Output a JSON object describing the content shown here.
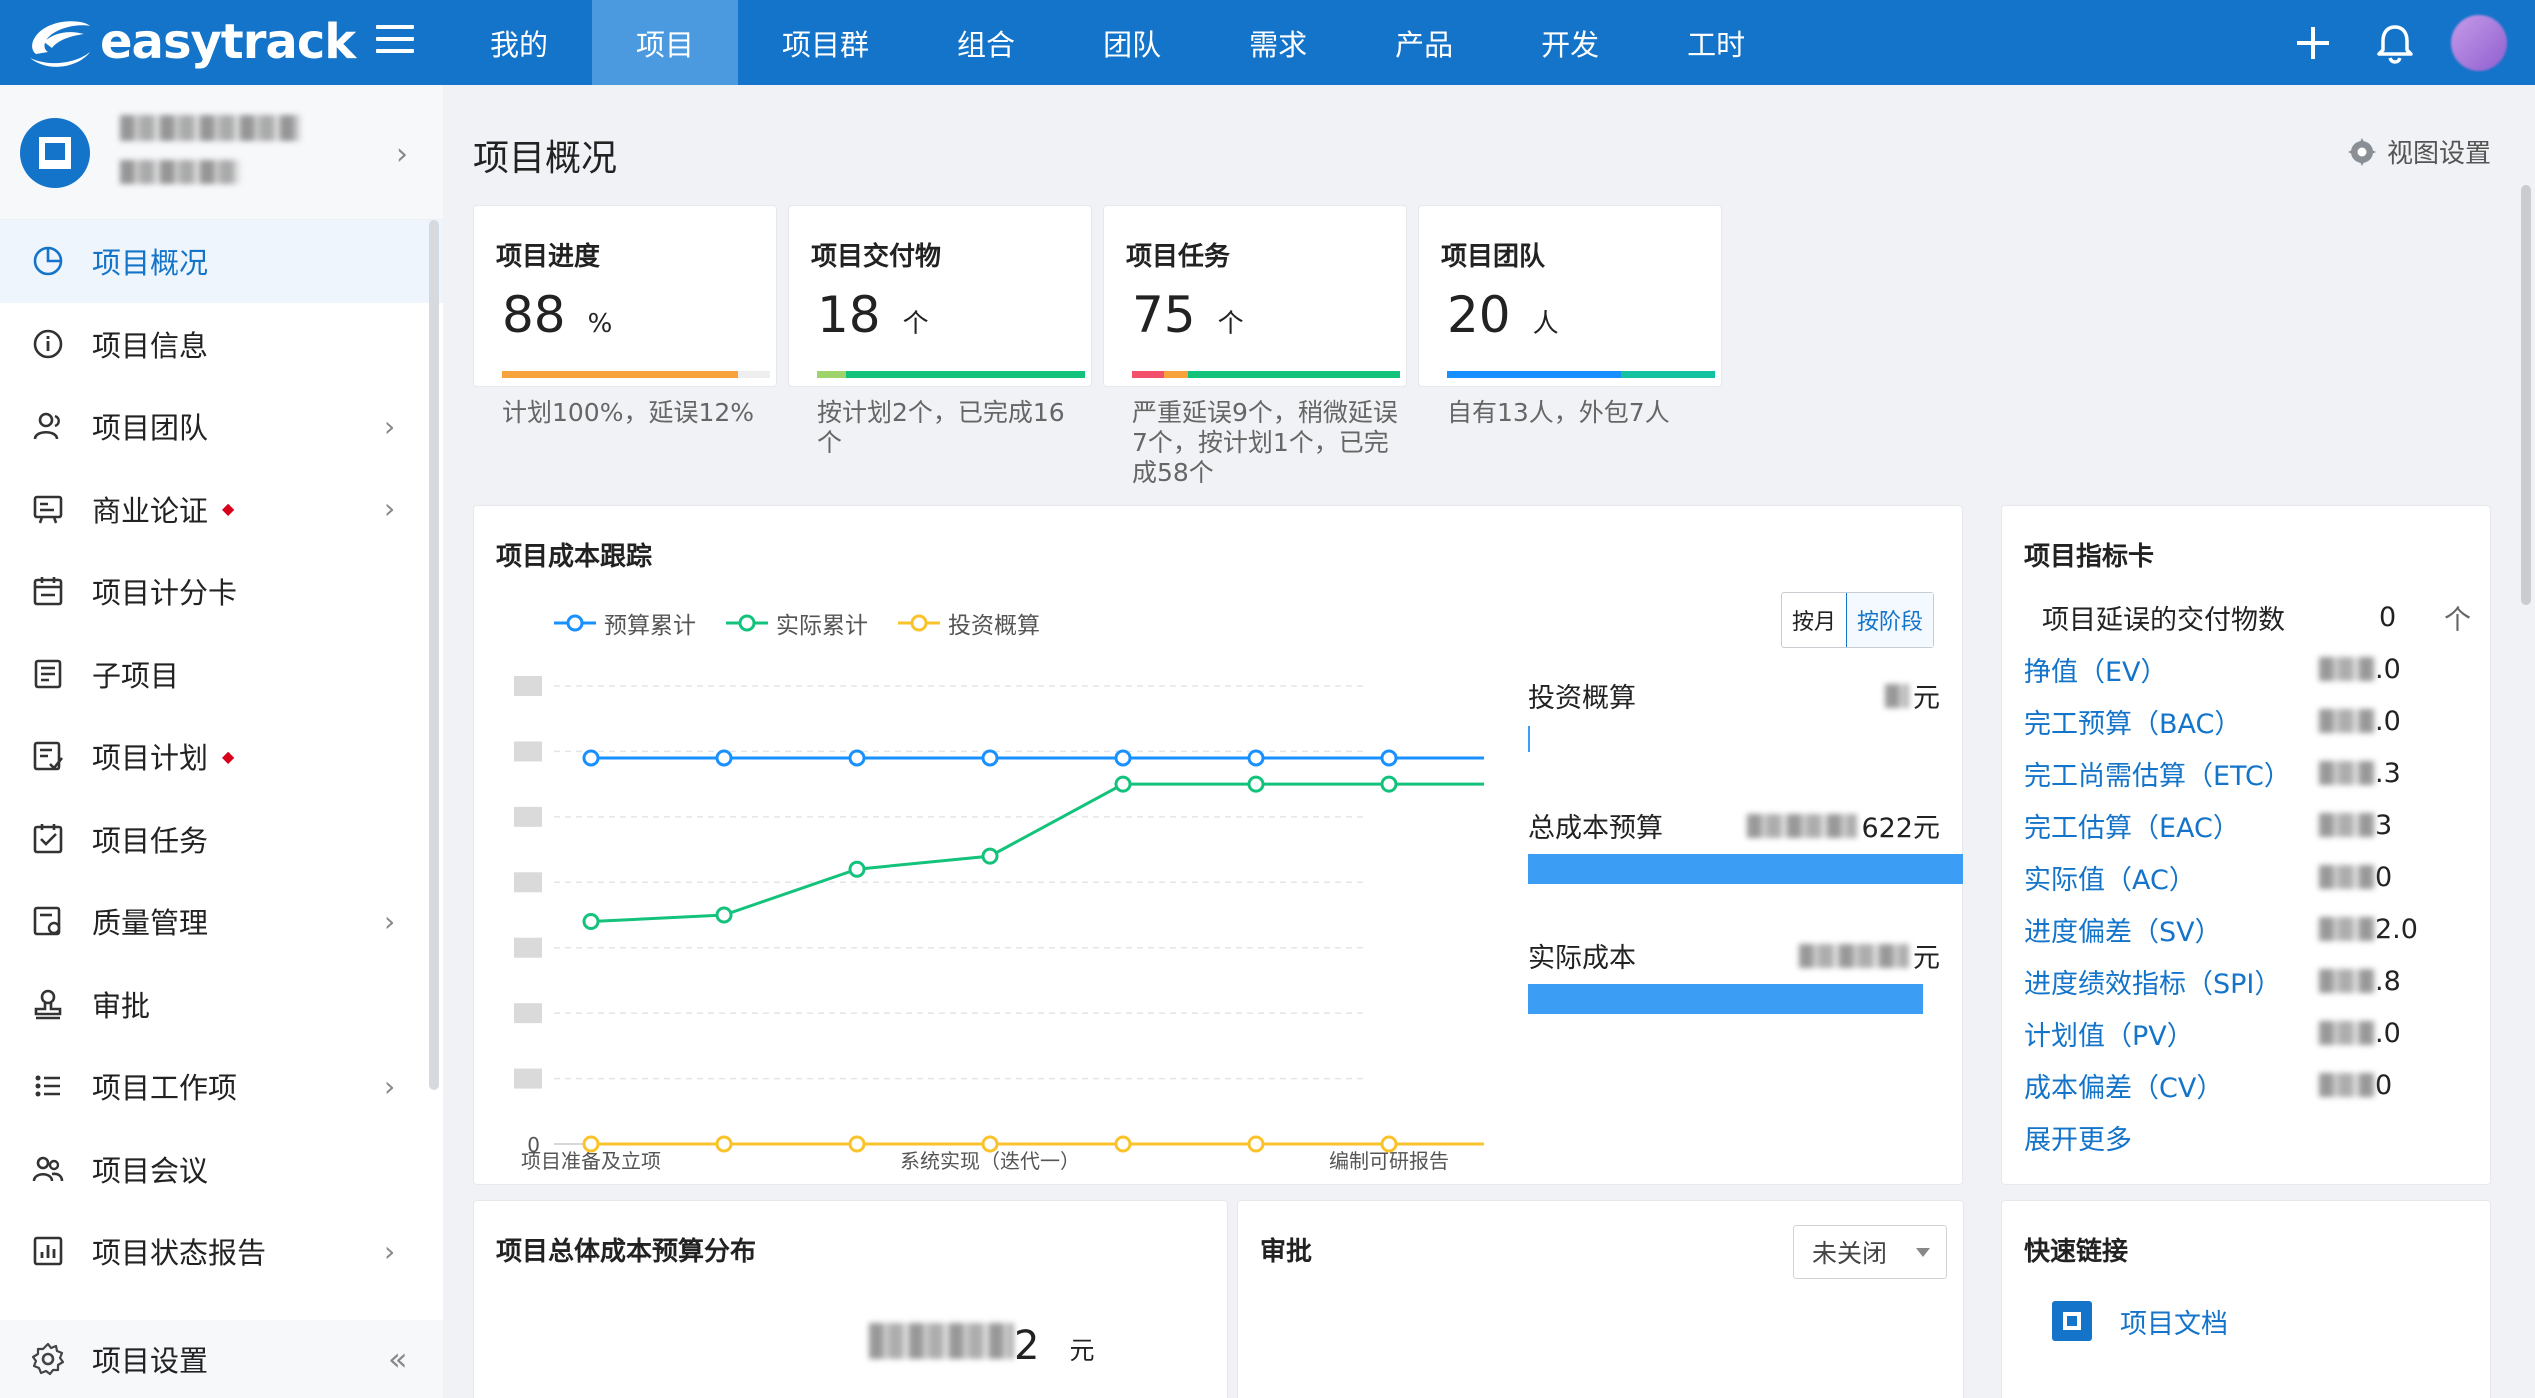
{
  "app": {
    "name": "easytrack"
  },
  "nav": {
    "items": [
      "我的",
      "项目",
      "项目群",
      "组合",
      "团队",
      "需求",
      "产品",
      "开发",
      "工时"
    ],
    "active_index": 1
  },
  "sidebar": {
    "items": [
      {
        "label": "项目概况",
        "icon": "pie-chart-icon",
        "active": true,
        "chevron": false,
        "dot": false
      },
      {
        "label": "项目信息",
        "icon": "info-icon",
        "active": false,
        "chevron": false,
        "dot": false
      },
      {
        "label": "项目团队",
        "icon": "team-icon",
        "active": false,
        "chevron": true,
        "dot": false
      },
      {
        "label": "商业论证",
        "icon": "business-case-icon",
        "active": false,
        "chevron": true,
        "dot": true
      },
      {
        "label": "项目计分卡",
        "icon": "scorecard-icon",
        "active": false,
        "chevron": false,
        "dot": false
      },
      {
        "label": "子项目",
        "icon": "subproject-icon",
        "active": false,
        "chevron": false,
        "dot": false
      },
      {
        "label": "项目计划",
        "icon": "plan-icon",
        "active": false,
        "chevron": false,
        "dot": true
      },
      {
        "label": "项目任务",
        "icon": "task-icon",
        "active": false,
        "chevron": false,
        "dot": false
      },
      {
        "label": "质量管理",
        "icon": "quality-icon",
        "active": false,
        "chevron": true,
        "dot": false
      },
      {
        "label": "审批",
        "icon": "approval-icon",
        "active": false,
        "chevron": false,
        "dot": false
      },
      {
        "label": "项目工作项",
        "icon": "work-items-icon",
        "active": false,
        "chevron": true,
        "dot": false
      },
      {
        "label": "项目会议",
        "icon": "meeting-icon",
        "active": false,
        "chevron": false,
        "dot": false
      },
      {
        "label": "项目状态报告",
        "icon": "status-report-icon",
        "active": false,
        "chevron": true,
        "dot": false
      }
    ],
    "footer": {
      "label": "项目设置",
      "icon": "gear-icon"
    }
  },
  "page": {
    "title": "项目概况",
    "view_settings": "视图设置"
  },
  "kpis": [
    {
      "title": "项目进度",
      "value": "88",
      "unit": "%",
      "note": "计划100%，延误12%",
      "progress": 0.88
    },
    {
      "title": "项目交付物",
      "value": "18",
      "unit": "个",
      "note": "按计划2个，已完成16个"
    },
    {
      "title": "项目任务",
      "value": "75",
      "unit": "个",
      "note": "严重延误9个，稍微延误7个，按计划1个，已完成58个"
    },
    {
      "title": "项目团队",
      "value": "20",
      "unit": "人",
      "note": "自有13人，外包7人"
    }
  ],
  "cost_tracking": {
    "title": "项目成本跟踪",
    "legend": [
      "预算累计",
      "实际累计",
      "投资概算"
    ],
    "toggle": [
      "按月",
      "按阶段"
    ],
    "toggle_active": 1,
    "x_labels": [
      "项目准备及立项",
      "系统实现（迭代一）",
      "编制可研报告"
    ],
    "y_zero": "0",
    "rows": [
      {
        "label": "投资概算",
        "suffix": "元"
      },
      {
        "label": "总成本预算",
        "suffix": "622元"
      },
      {
        "label": "实际成本",
        "suffix": "元"
      }
    ]
  },
  "chart_data": {
    "type": "line",
    "title": "项目成本跟踪",
    "x": [
      1,
      2,
      3,
      4,
      5,
      6,
      7,
      8
    ],
    "tick_labels": [
      "项目准备及立项",
      "系统实现（迭代一）",
      "编制可研报告"
    ],
    "series": [
      {
        "name": "预算累计",
        "color": "#1890ff",
        "values": [
          5.9,
          5.9,
          5.9,
          5.9,
          5.9,
          5.9,
          5.9,
          5.9
        ]
      },
      {
        "name": "实际累计",
        "color": "#13c27b",
        "values": [
          3.4,
          3.5,
          4.2,
          4.4,
          5.5,
          5.5,
          5.5,
          5.5
        ]
      },
      {
        "name": "投资概算",
        "color": "#fac22b",
        "values": [
          0,
          0,
          0,
          0,
          0,
          0,
          0,
          0
        ]
      }
    ],
    "ylim": [
      0,
      7
    ],
    "grid": true,
    "legend_position": "top-left"
  },
  "metrics": {
    "title": "项目指标卡",
    "items": [
      {
        "label": "项目延误的交付物数",
        "value": "0",
        "unit": "个",
        "link": false
      },
      {
        "label": "挣值（EV）",
        "value": ".0",
        "link": true
      },
      {
        "label": "完工预算（BAC）",
        "value": ".0",
        "link": true
      },
      {
        "label": "完工尚需估算（ETC）",
        "value": ".3",
        "link": true
      },
      {
        "label": "完工估算（EAC）",
        "value": "3",
        "link": true
      },
      {
        "label": "实际值（AC）",
        "value": "0",
        "link": true
      },
      {
        "label": "进度偏差（SV）",
        "value": "2.0",
        "link": true
      },
      {
        "label": "进度绩效指标（SPI）",
        "value": ".8",
        "link": true
      },
      {
        "label": "计划值（PV）",
        "value": ".0",
        "link": true
      },
      {
        "label": "成本偏差（CV）",
        "value": "0",
        "link": true
      }
    ],
    "more": "展开更多"
  },
  "budget_dist": {
    "title": "项目总体成本预算分布",
    "value_tail": "2",
    "unit": "元"
  },
  "approval": {
    "title": "审批",
    "filter": "未关闭"
  },
  "quick_links": {
    "title": "快速链接",
    "items": [
      "项目文档"
    ]
  }
}
